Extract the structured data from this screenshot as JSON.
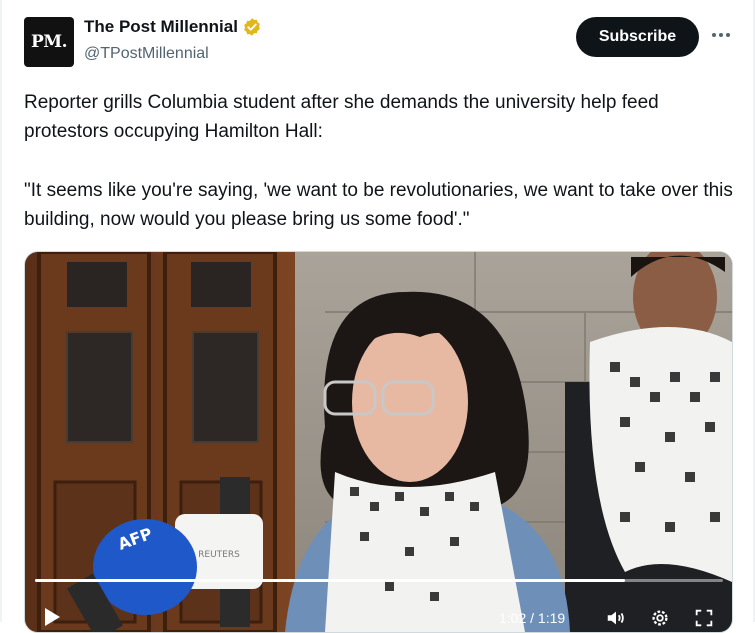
{
  "account": {
    "avatar_text": "PM.",
    "display_name": "The Post Millennial",
    "handle": "@TPostMillennial",
    "verified_color": "#e2b719"
  },
  "actions": {
    "subscribe_label": "Subscribe",
    "more_icon": "ellipsis-icon"
  },
  "tweet": {
    "line1": "Reporter grills Columbia student after she demands the university help feed protestors occupying Hamilton Hall:",
    "line2": "\"It seems like you're saying, 'we want to be revolutionaries, we want to take over this building, now would you please bring us some food'.\""
  },
  "video": {
    "mic_labels": [
      "AFP",
      "REUTERS"
    ],
    "progress_fraction": 0.857,
    "time_text": "1:02 / 1:19",
    "controls": [
      "play-icon",
      "volume-icon",
      "settings-icon",
      "fullscreen-icon"
    ]
  },
  "colors": {
    "text": "#0f1419",
    "muted": "#536471",
    "subscribe_bg": "#0f1419"
  }
}
